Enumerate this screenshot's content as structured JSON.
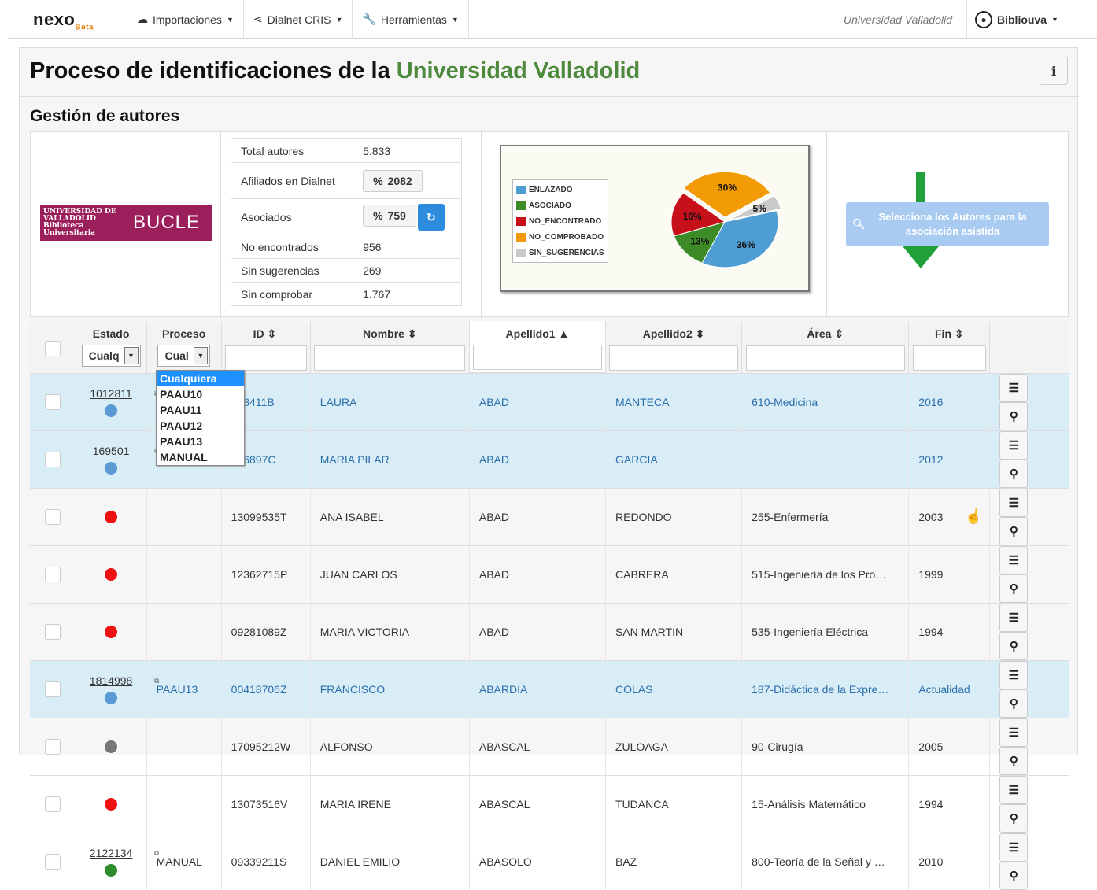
{
  "nav": {
    "brand": "nexo",
    "brand_sub": "Beta",
    "imports": "Importaciones",
    "dialnet": "Dialnet CRIS",
    "tools": "Herramientas",
    "university": "Universidad Valladolid",
    "user": "Bibliouva"
  },
  "page": {
    "title_a": "Proceso de identificaciones de la ",
    "title_b": "Universidad Valladolid",
    "info": "i",
    "section": "Gestión de autores"
  },
  "logo": {
    "line1": "UNIVERSIDAD DE VALLADOLID Biblioteca Universitaria",
    "line2": "BUCLE"
  },
  "stats": [
    {
      "label": "Total autores",
      "value": "5.833"
    },
    {
      "label": "Afiliados en Dialnet",
      "value": "2082"
    },
    {
      "label": "Asociados",
      "value": "759"
    },
    {
      "label": "No encontrados",
      "value": "956"
    },
    {
      "label": "Sin sugerencias",
      "value": "269"
    },
    {
      "label": "Sin comprobar",
      "value": "1.767"
    }
  ],
  "chart_data": {
    "type": "pie",
    "series": [
      {
        "name": "ENLAZADO",
        "value": 36,
        "label": "36%",
        "color": "#4f9ed3"
      },
      {
        "name": "ASOCIADO",
        "value": 13,
        "label": "13%",
        "color": "#3d8b27"
      },
      {
        "name": "NO_ENCONTRADO",
        "value": 16,
        "label": "16%",
        "color": "#c8101a"
      },
      {
        "name": "NO_COMPROBADO",
        "value": 30,
        "label": "30%",
        "color": "#f29b07"
      },
      {
        "name": "SIN_SUGERENCIAS",
        "value": 5,
        "label": "5%",
        "color": "#c9c9c9"
      }
    ]
  },
  "assist_button": "Selecciona los Autores para la asociación asistida",
  "columns": {
    "estado": "Estado",
    "proceso": "Proceso",
    "id": "ID ⇕",
    "nombre": "Nombre ⇕",
    "ap1": "Apellido1 ▲",
    "ap2": "Apellido2 ⇕",
    "area": "Área ⇕",
    "fin": "Fin ⇕"
  },
  "filters": {
    "estado": "Cualq",
    "proceso": "Cual"
  },
  "dropdown": [
    "Cualquiera",
    "PAAU10",
    "PAAU11",
    "PAAU12",
    "PAAU13",
    "MANUAL"
  ],
  "rows": [
    {
      "link": "1012811",
      "dot": "#5b9bd5",
      "proceso": "",
      "id": "308411B",
      "nombre": "LAURA",
      "ap1": "ABAD",
      "ap2": "MANTECA",
      "area": "610-Medicina",
      "fin": "2016",
      "hl": true
    },
    {
      "link": "169501",
      "dot": "#5b9bd5",
      "proceso": "",
      "id": "366897C",
      "nombre": "MARIA PILAR",
      "ap1": "ABAD",
      "ap2": "GARCIA",
      "area": "",
      "fin": "2012",
      "hl": true
    },
    {
      "link": "",
      "dot": "#ee1111",
      "proceso": "",
      "id": "13099535T",
      "nombre": "ANA ISABEL",
      "ap1": "ABAD",
      "ap2": "REDONDO",
      "area": "255-Enfermería",
      "fin": "2003",
      "hl": false
    },
    {
      "link": "",
      "dot": "#ee1111",
      "proceso": "",
      "id": "12362715P",
      "nombre": "JUAN CARLOS",
      "ap1": "ABAD",
      "ap2": "CABRERA",
      "area": "515-Ingeniería de los Pro…",
      "fin": "1999",
      "hl": false
    },
    {
      "link": "",
      "dot": "#ee1111",
      "proceso": "",
      "id": "09281089Z",
      "nombre": "MARIA VICTORIA",
      "ap1": "ABAD",
      "ap2": "SAN MARTIN",
      "area": "535-Ingeniería Eléctrica",
      "fin": "1994",
      "hl": false
    },
    {
      "link": "1814998",
      "dot": "#5b9bd5",
      "proceso": "PAAU13",
      "id": "00418706Z",
      "nombre": "FRANCISCO",
      "ap1": "ABARDIA",
      "ap2": "COLAS",
      "area": "187-Didáctica de la Expre…",
      "fin": "Actualidad",
      "hl": true
    },
    {
      "link": "",
      "dot": "#777777",
      "proceso": "",
      "id": "17095212W",
      "nombre": "ALFONSO",
      "ap1": "ABASCAL",
      "ap2": "ZULOAGA",
      "area": "90-Cirugía",
      "fin": "2005",
      "hl": false
    },
    {
      "link": "",
      "dot": "#ee1111",
      "proceso": "",
      "id": "13073516V",
      "nombre": "MARIA IRENE",
      "ap1": "ABASCAL",
      "ap2": "TUDANCA",
      "area": "15-Análisis Matemático",
      "fin": "1994",
      "hl": false
    },
    {
      "link": "2122134",
      "dot": "#2e8b2e",
      "proceso": "MANUAL",
      "id": "09339211S",
      "nombre": "DANIEL EMILIO",
      "ap1": "ABASOLO",
      "ap2": "BAZ",
      "area": "800-Teoría de la Señal y …",
      "fin": "2010",
      "hl": false
    }
  ]
}
